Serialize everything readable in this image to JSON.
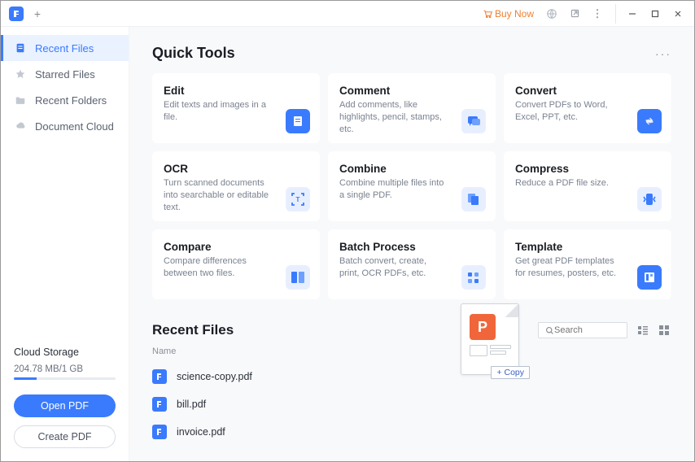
{
  "titlebar": {
    "buy_now": "Buy Now"
  },
  "sidebar": {
    "items": [
      {
        "label": "Recent Files"
      },
      {
        "label": "Starred Files"
      },
      {
        "label": "Recent Folders"
      },
      {
        "label": "Document Cloud"
      }
    ],
    "cloud": {
      "title": "Cloud Storage",
      "usage": "204.78 MB/1 GB",
      "open_pdf": "Open PDF",
      "create_pdf": "Create PDF"
    }
  },
  "quick_tools": {
    "title": "Quick Tools",
    "cards": [
      {
        "title": "Edit",
        "desc": "Edit texts and images in a file."
      },
      {
        "title": "Comment",
        "desc": "Add comments, like highlights, pencil, stamps, etc."
      },
      {
        "title": "Convert",
        "desc": "Convert PDFs to Word, Excel, PPT, etc."
      },
      {
        "title": "OCR",
        "desc": "Turn scanned documents into searchable or editable text."
      },
      {
        "title": "Combine",
        "desc": "Combine multiple files into a single PDF."
      },
      {
        "title": "Compress",
        "desc": "Reduce a PDF file size."
      },
      {
        "title": "Compare",
        "desc": "Compare differences between two files."
      },
      {
        "title": "Batch Process",
        "desc": "Batch convert, create, print, OCR PDFs, etc."
      },
      {
        "title": "Template",
        "desc": "Get great PDF templates for resumes, posters, etc."
      }
    ]
  },
  "recent": {
    "title": "Recent Files",
    "col_name": "Name",
    "search_placeholder": "Search",
    "files": [
      {
        "name": "science-copy.pdf"
      },
      {
        "name": "bill.pdf"
      },
      {
        "name": "invoice.pdf"
      }
    ]
  },
  "drag": {
    "copy_label": "Copy"
  }
}
